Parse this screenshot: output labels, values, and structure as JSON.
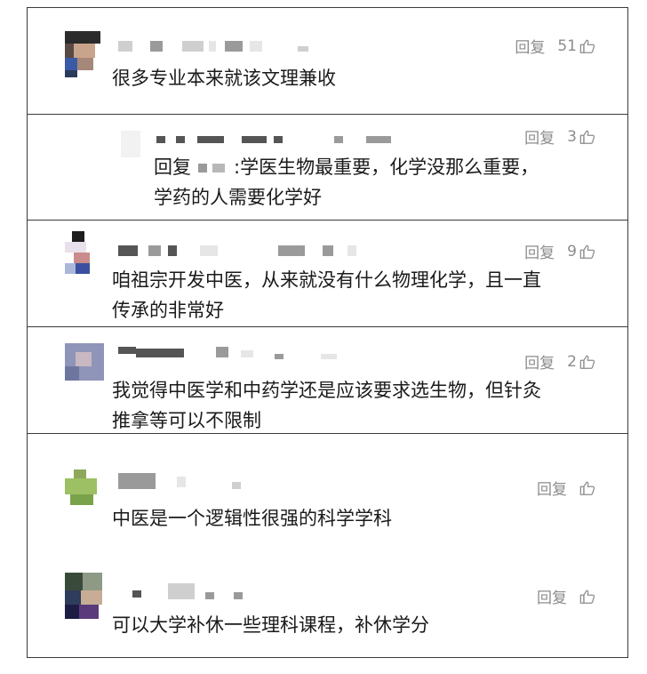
{
  "labels": {
    "reply": "回复"
  },
  "comments": [
    {
      "likes": "51",
      "text_lines": [
        "很多专业本来就该文理兼收"
      ]
    },
    {
      "likes": "3",
      "reply_prefix": "回复",
      "reply_suffix": ":",
      "text_lines": [
        "学医生物最重要，化学没那么重要，",
        "学药的人需要化学好"
      ]
    },
    {
      "likes": "9",
      "text_lines": [
        "咱祖宗开发中医，从来就没有什么物理化学，且一直",
        "传承的非常好"
      ]
    },
    {
      "likes": "2",
      "text_lines": [
        "我觉得中医学和中药学还是应该要求选生物，但针灸",
        "推拿等可以不限制"
      ]
    },
    {
      "likes": "",
      "text_lines": [
        "中医是一个逻辑性很强的科学学科"
      ]
    },
    {
      "likes": "",
      "text_lines": [
        "可以大学补休一些理科课程，补休学分"
      ]
    }
  ],
  "colors": {
    "text": "#1a1a1a",
    "meta": "#8c8c8c",
    "border": "#3a3a3a"
  },
  "icons": {
    "like": "thumbs-up-icon"
  }
}
